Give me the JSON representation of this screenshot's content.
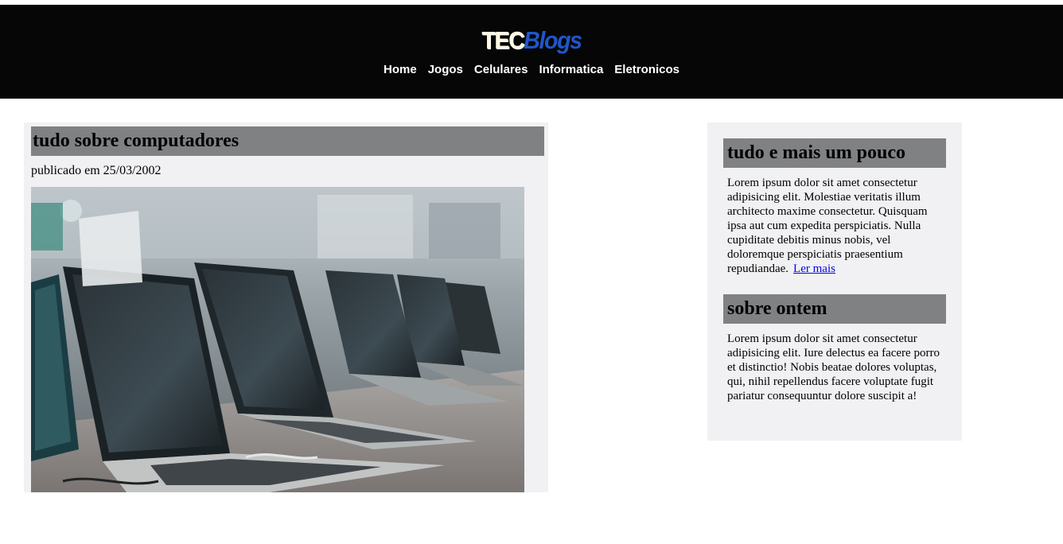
{
  "header": {
    "logo_part1": "TEC",
    "logo_part2": "Blogs",
    "nav": [
      "Home",
      "Jogos",
      "Celulares",
      "Informatica",
      "Eletronicos"
    ]
  },
  "post": {
    "title": "tudo sobre computadores",
    "date": "publicado em 25/03/2002",
    "image_alt": "laptops on display"
  },
  "sidebar": {
    "section1_title": "tudo e mais um pouco",
    "section1_text": "Lorem ipsum dolor sit amet consectetur adipisicing elit. Molestiae veritatis illum architecto maxime consectetur. Quisquam ipsa aut cum expedita perspiciatis. Nulla cupiditate debitis minus nobis, vel doloremque perspiciatis praesentium repudiandae.",
    "section1_link": "Ler mais",
    "section2_title": "sobre ontem",
    "section2_text": "Lorem ipsum dolor sit amet consectetur adipisicing elit. Iure delectus ea facere porro et distinctio! Nobis beatae dolores voluptas, qui, nihil repellendus facere voluptate fugit pariatur consequuntur dolore suscipit a!"
  }
}
